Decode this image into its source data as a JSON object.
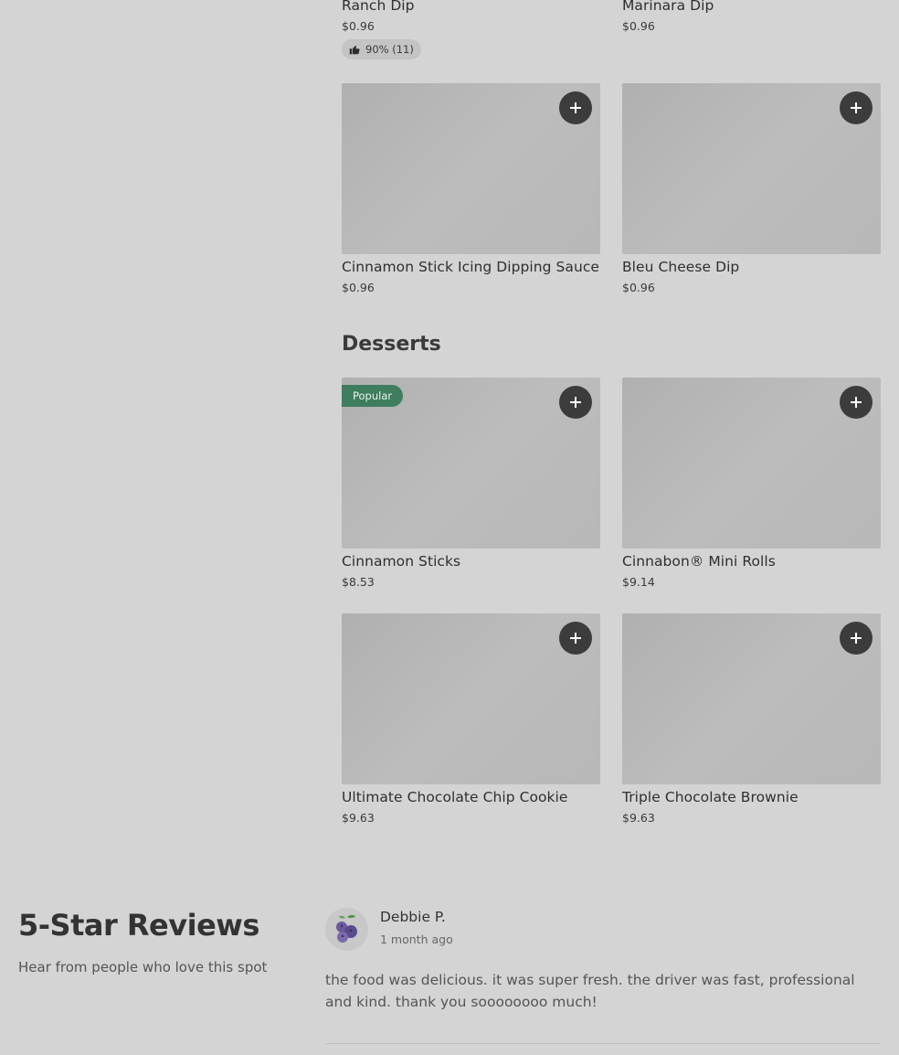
{
  "sauces": {
    "items": [
      {
        "name": "Ranch Dip",
        "price": "$0.96",
        "rating": "90% (11)"
      },
      {
        "name": "Marinara Dip",
        "price": "$0.96"
      },
      {
        "name": "Cinnamon Stick Icing Dipping Sauce",
        "price": "$0.96"
      },
      {
        "name": "Bleu Cheese Dip",
        "price": "$0.96"
      }
    ]
  },
  "desserts": {
    "title": "Desserts",
    "popular_label": "Popular",
    "items": [
      {
        "name": "Cinnamon Sticks",
        "price": "$8.53"
      },
      {
        "name": "Cinnabon® Mini Rolls",
        "price": "$9.14"
      },
      {
        "name": "Ultimate Chocolate Chip Cookie",
        "price": "$9.63"
      },
      {
        "name": "Triple Chocolate Brownie",
        "price": "$9.63"
      }
    ]
  },
  "reviews": {
    "heading": "5-Star Reviews",
    "subheading": "Hear from people who love this spot",
    "items": [
      {
        "reviewer": "Debbie P.",
        "time": "1 month ago",
        "text": "the food was delicious. it was super fresh. the driver was fast, professional and kind. thank you soooooooo much!"
      }
    ]
  },
  "icons": {
    "add": "plus-icon",
    "rating": "thumbs-up-icon",
    "avatar": "blueberry-avatar-icon"
  },
  "colors": {
    "popular_badge": "#3e7d5e",
    "add_button": "#3c3c3c",
    "background": "#d4d4d4"
  }
}
